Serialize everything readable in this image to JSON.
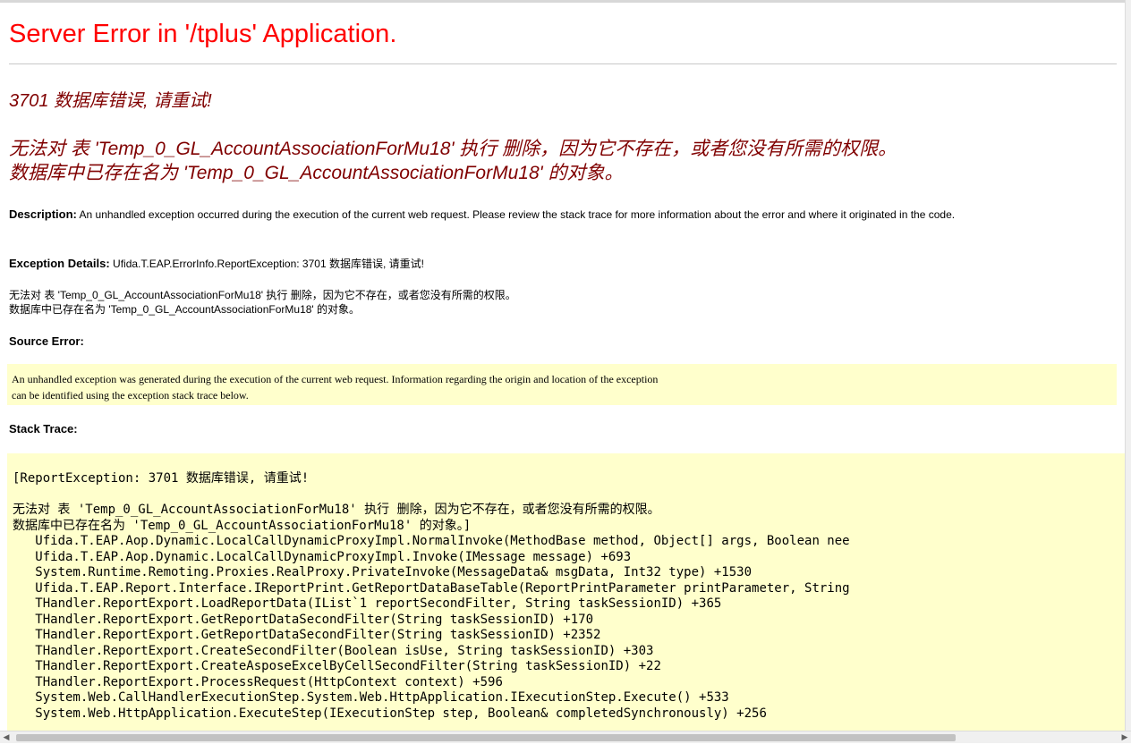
{
  "page": {
    "title": "Server Error in '/tplus' Application.",
    "error_code_line": "3701 数据库错误, 请重试!",
    "error_message_lines": [
      "无法对 表 'Temp_0_GL_AccountAssociationForMu18' 执行 删除，因为它不存在，或者您没有所需的权限。",
      "数据库中已存在名为 'Temp_0_GL_AccountAssociationForMu18' 的对象。"
    ]
  },
  "description": {
    "label": "Description:",
    "text": " An unhandled exception occurred during the execution of the current web request. Please review the stack trace for more information about the error and where it originated in the code."
  },
  "exception_details": {
    "label": "Exception Details:",
    "text": " Ufida.T.EAP.ErrorInfo.ReportException: 3701 数据库错误, 请重试!",
    "message_lines": [
      "无法对 表 'Temp_0_GL_AccountAssociationForMu18' 执行 删除，因为它不存在，或者您没有所需的权限。",
      "数据库中已存在名为 'Temp_0_GL_AccountAssociationForMu18' 的对象。"
    ]
  },
  "source_error": {
    "label": "Source Error:",
    "lines": [
      "An unhandled exception was generated during the execution of the current web request. Information regarding the origin and location of the exception",
      "can be identified using the exception stack trace below."
    ]
  },
  "stack_trace": {
    "label": "Stack Trace:",
    "header_line": "[ReportException: 3701 数据库错误, 请重试!",
    "message_lines": [
      "无法对 表 'Temp_0_GL_AccountAssociationForMu18' 执行 删除，因为它不存在，或者您没有所需的权限。",
      "数据库中已存在名为 'Temp_0_GL_AccountAssociationForMu18' 的对象。]"
    ],
    "frames": [
      "   Ufida.T.EAP.Aop.Dynamic.LocalCallDynamicProxyImpl.NormalInvoke(MethodBase method, Object[] args, Boolean nee",
      "   Ufida.T.EAP.Aop.Dynamic.LocalCallDynamicProxyImpl.Invoke(IMessage message) +693",
      "   System.Runtime.Remoting.Proxies.RealProxy.PrivateInvoke(MessageData& msgData, Int32 type) +1530",
      "   Ufida.T.EAP.Report.Interface.IReportPrint.GetReportDataBaseTable(ReportPrintParameter printParameter, String",
      "   THandler.ReportExport.LoadReportData(IList`1 reportSecondFilter, String taskSessionID) +365",
      "   THandler.ReportExport.GetReportDataSecondFilter(String taskSessionID) +170",
      "   THandler.ReportExport.GetReportDataSecondFilter(String taskSessionID) +2352",
      "   THandler.ReportExport.CreateSecondFilter(Boolean isUse, String taskSessionID) +303",
      "   THandler.ReportExport.CreateAsposeExcelByCellSecondFilter(String taskSessionID) +22",
      "   THandler.ReportExport.ProcessRequest(HttpContext context) +596",
      "   System.Web.CallHandlerExecutionStep.System.Web.HttpApplication.IExecutionStep.Execute() +533",
      "   System.Web.HttpApplication.ExecuteStep(IExecutionStep step, Boolean& completedSynchronously) +256"
    ]
  },
  "scrollbar": {
    "left_arrow": "◀",
    "right_arrow": "▶"
  }
}
